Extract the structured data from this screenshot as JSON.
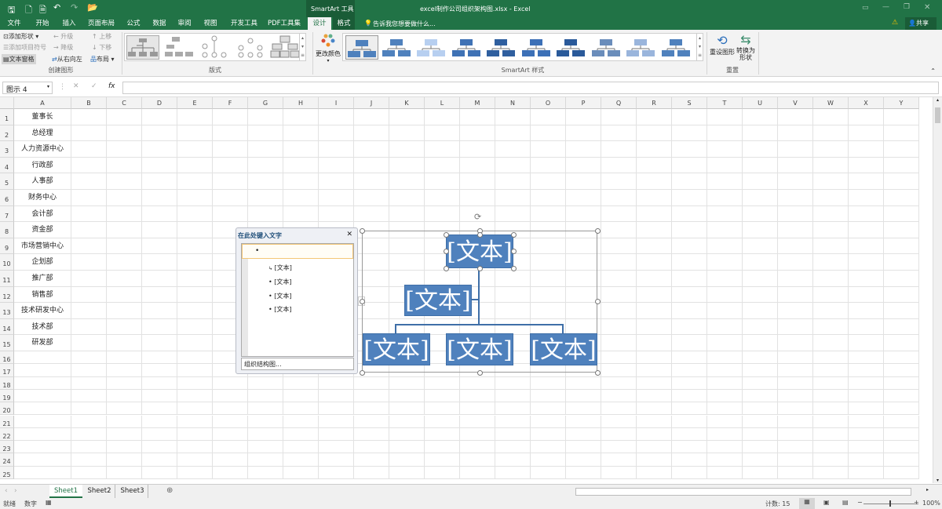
{
  "titlebar": {
    "smartart_tools": "SmartArt 工具",
    "title": "excel制作公司组织架构图.xlsx - Excel",
    "share": "共享"
  },
  "tabs": [
    "文件",
    "开始",
    "插入",
    "页面布局",
    "公式",
    "数据",
    "审阅",
    "视图",
    "开发工具",
    "PDF工具集",
    "设计",
    "格式"
  ],
  "tell_me": "告诉我您想要做什么...",
  "ribbon": {
    "create": {
      "add_shape": "添加形状",
      "add_bullet": "添加项目符号",
      "text_pane": "文本窗格",
      "promote": "升级",
      "demote": "降级",
      "rtl": "从右向左",
      "move_up": "上移",
      "move_down": "下移",
      "layout": "布局",
      "label": "创建图形"
    },
    "layouts_label": "版式",
    "change_colors": "更改颜色",
    "styles_label": "SmartArt 样式",
    "reset": {
      "reset_graphic": "重设图形",
      "convert": "转换为形状",
      "label": "重置"
    }
  },
  "formula_bar": {
    "name_box": "图示 4",
    "fx": "fx",
    "value": ""
  },
  "columns": [
    "A",
    "B",
    "C",
    "D",
    "E",
    "F",
    "G",
    "H",
    "I",
    "J",
    "K",
    "L",
    "M",
    "N",
    "O",
    "P",
    "Q",
    "R",
    "S",
    "T",
    "U",
    "V",
    "W",
    "X",
    "Y"
  ],
  "column_a": [
    "董事长",
    "总经理",
    "人力资源中心",
    "行政部",
    "人事部",
    "财务中心",
    "会计部",
    "资金部",
    "市场营销中心",
    "企划部",
    "推广部",
    "销售部",
    "技术研发中心",
    "技术部",
    "研发部"
  ],
  "row_count": 25,
  "text_pane": {
    "title": "在此处键入文字",
    "items": [
      "",
      "[文本]",
      "[文本]",
      "[文本]",
      "[文本]"
    ],
    "footer": "组织结构图..."
  },
  "smartart": {
    "top": "[文本]",
    "assistant": "[文本]",
    "children": [
      "[文本]",
      "[文本]",
      "[文本]"
    ]
  },
  "sheets": [
    "Sheet1",
    "Sheet2",
    "Sheet3"
  ],
  "active_sheet": "Sheet1",
  "status": {
    "ready": "就绪",
    "mode": "数字",
    "count": "计数: 15",
    "zoom": "100%"
  },
  "colors": {
    "brand": "#217346",
    "shape": "#4f81bd"
  }
}
